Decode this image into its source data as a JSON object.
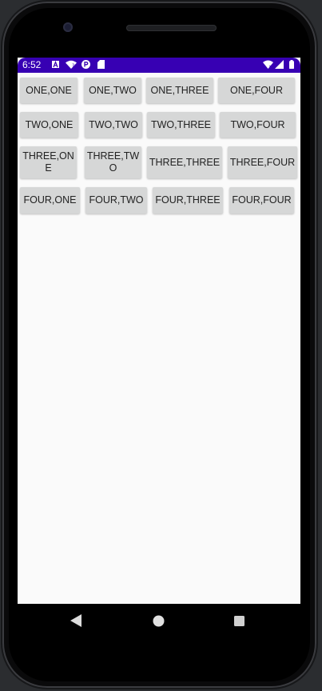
{
  "status_bar": {
    "time": "6:52",
    "icons_left": [
      "a-notification-icon",
      "wifi-question-icon",
      "p-icon",
      "sd-card-icon"
    ],
    "icons_right": [
      "wifi-x-icon",
      "signal-icon",
      "battery-icon"
    ]
  },
  "colors": {
    "status_bar": "#3700b3",
    "button_bg": "#d6d7d7",
    "screen_bg": "#fafafa"
  },
  "grid": {
    "rows": [
      {
        "buttons": [
          "ONE,ONE",
          "ONE,TWO",
          "ONE,THREE",
          "ONE,FOUR"
        ]
      },
      {
        "buttons": [
          "TWO,ONE",
          "TWO,TWO",
          "TWO,THREE",
          "TWO,FOUR"
        ]
      },
      {
        "buttons": [
          "THREE,ONE",
          "THREE,TWO",
          "THREE,THREE",
          "THREE,FOUR"
        ]
      },
      {
        "buttons": [
          "FOUR,ONE",
          "FOUR,TWO",
          "FOUR,THREE",
          "FOUR,FOUR"
        ]
      }
    ]
  },
  "nav_bar": {
    "back": "back-icon",
    "home": "home-icon",
    "recents": "recents-icon"
  }
}
